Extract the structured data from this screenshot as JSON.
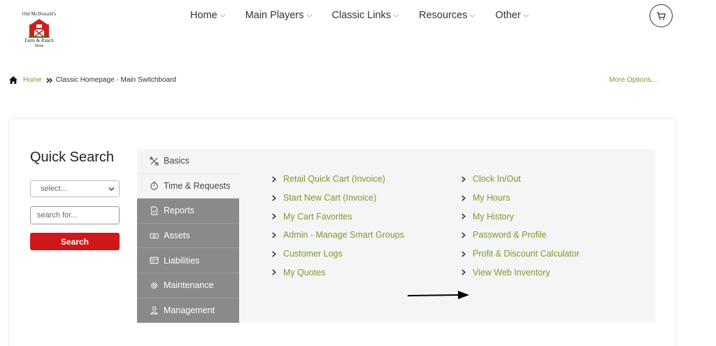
{
  "logo": {
    "line1": "Old McDonald's",
    "line2": "Farm & Ranch",
    "line3": "Store"
  },
  "nav": [
    {
      "label": "Home"
    },
    {
      "label": "Main Players"
    },
    {
      "label": "Classic Links"
    },
    {
      "label": "Resources"
    },
    {
      "label": "Other"
    }
  ],
  "breadcrumb": {
    "home": "Home",
    "current": "Classic Homepage - Main Switchboard"
  },
  "more_options": "More Options...",
  "quick_search": {
    "title": "Quick Search",
    "select_value": "select...",
    "input_placeholder": "search for...",
    "button_label": "Search"
  },
  "tabs": [
    {
      "label": "Basics",
      "icon": "tools-icon"
    },
    {
      "label": "Time & Requests",
      "icon": "stopwatch-icon"
    },
    {
      "label": "Reports",
      "icon": "document-icon"
    },
    {
      "label": "Assets",
      "icon": "money-icon"
    },
    {
      "label": "Liabilities",
      "icon": "ledger-icon"
    },
    {
      "label": "Maintenance",
      "icon": "gear-icon"
    },
    {
      "label": "Management",
      "icon": "person-icon"
    }
  ],
  "links_col1": [
    "Retail Quick Cart (Invoice)",
    "Start New Cart (Invoice)",
    "My Cart Favorites",
    "Admin - Manage Smart Groups",
    "Customer Logs",
    "My Quotes"
  ],
  "links_col2": [
    "Clock In/Out",
    "My Hours",
    "My History",
    "Password & Profile",
    "Profit & Discount Calculator",
    "View Web Inventory"
  ],
  "colors": {
    "link": "#7a9a2c",
    "button": "#d01818",
    "tab_dark": "#8a8a8a",
    "panel": "#f5f5f5"
  }
}
